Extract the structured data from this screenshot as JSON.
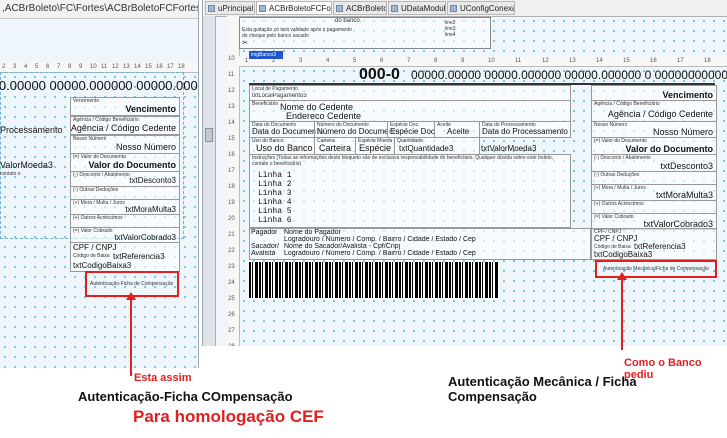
{
  "left": {
    "path": ",ACBrBoleto\\FC\\Fortes\\ACBrBoletoFCFortesFr.pas",
    "ruler_ticks": [
      "2",
      "3",
      "4",
      "5",
      "6",
      "7",
      "8",
      "9",
      "10",
      "11",
      "12",
      "13",
      "14",
      "15",
      "16",
      "17",
      "18"
    ],
    "row_numbers": [
      "12",
      "13",
      "14",
      "15",
      "16",
      "17",
      "18",
      "19",
      "20",
      "21"
    ],
    "linha_digitavel": "00000.00000 00000.000000 00000.000000 0 00000000000000",
    "labels": {
      "vencimento_small": "Vencimento",
      "agencia_small": "Agência / Código Beneficiário",
      "nosso_small": "Nosso Número",
      "valor_small": "(=) Valor do Documento",
      "desconto_small": "(-) Desconto / Abatimento",
      "outras_ded_small": "(-) Outras Deduções",
      "mora_small": "(+) Mora / Multa / Juros",
      "outros_acr_small": "(+) Outros Acréscimos",
      "cobrado_small": "(=) Valor Cobrado",
      "codigo_baixa_small": "Código de Baixa",
      "contato_small": "contato o"
    },
    "vencimento": "Vencimento",
    "agencia": "Agência / Código Cedente",
    "data_proc": "Processamento",
    "nosso_numero": "Nosso Número",
    "valor_moeda": "ValorMoeda3",
    "valor_documento": "Valor do Documento",
    "txt_desconto": "txtDesconto3",
    "txt_mora": "txtMoraMulta3",
    "txt_valor_cobrado": "txtValorCobrado3",
    "cpf": "CPF / CNPJ",
    "txt_referencia": "txtReferencia3",
    "txt_codigo_baixa": "txtCodigoBaixa3",
    "autenticacao_box": "Autenticação-Ficha de Compensação"
  },
  "right": {
    "tabs": [
      {
        "label": "uPrincipal",
        "active": false
      },
      {
        "label": "ACBrBoletoFCFortesFr",
        "active": true
      },
      {
        "label": "ACBrBoleto",
        "active": false
      },
      {
        "label": "UDataModule",
        "active": false
      },
      {
        "label": "UConfigConexao",
        "active": false
      }
    ],
    "top_lines": [
      "line2",
      "line3",
      "line4"
    ],
    "top_text": "Esta quitação só terá validade após o pagamento do cheque pelo banco sacado",
    "do_banco": "do banco.",
    "row_numbers": [
      "10",
      "11",
      "12",
      "13",
      "14",
      "15",
      "16",
      "17",
      "18",
      "19",
      "20",
      "21",
      "22",
      "23",
      "24",
      "25",
      "26",
      "27",
      "28"
    ],
    "ruler_ticks": [
      "1",
      "2",
      "3",
      "4",
      "5",
      "6",
      "7",
      "8",
      "9",
      "10",
      "11",
      "12",
      "13",
      "14",
      "15",
      "16",
      "17",
      "18"
    ],
    "logo_field": "imgBanco3",
    "banco_numero": "000-0",
    "linha_digitavel": "00000.00000 00000.000000 00000.000000 0 00000000000000",
    "local_pagamento_label": "Local de Pagamento",
    "local_pagamento": "txtLocalPagamento3",
    "vencimento_label": "Vencimento",
    "vencimento": "Vencimento",
    "beneficiario_label": "Beneficiário",
    "nome_cedente": "Nome do Cedente",
    "endereco_cedente": "Endereco Cedente",
    "agencia_label": "Agência / Código Beneficiário",
    "agencia": "Agência / Código Cedente",
    "data_doc_label": "Data do Documento",
    "data_doc": "Data do Documento",
    "num_doc_label": "Número do Documento",
    "num_doc": "Número do Documento",
    "especie_doc_label": "Espécie Doc.",
    "especie_doc": "Espécie Doc",
    "aceite_label": "Aceite",
    "aceite": "Aceite",
    "data_proc_label": "Data do Processamento",
    "data_proc": "Data do Processamento",
    "nosso_label": "Nosso Número",
    "nosso": "Nosso Número",
    "uso_banco_label": "Uso do Banco",
    "uso_banco": "Uso do Banco",
    "carteira_label": "Carteira",
    "carteira": "Carteira",
    "especie_label": "Espécie Moeda",
    "especie": "Espécie",
    "quantidade_label": "Quantidade",
    "quantidade": "txtQuantidade3",
    "valor_moeda": "txtValorMoeda3",
    "valor_doc_label": "(=) Valor do Documento",
    "valor_doc": "Valor do Documento",
    "instrucoes": "Instruções (Todas as informações deste bloqueto são de exclusiva responsabilidade do beneficiário. Qualquer dúvida sobre este boleto, contate o beneficiário)",
    "linhas": [
      "Linha 1",
      "Linha 2",
      "Linha 3",
      "Linha 4",
      "Linha 5",
      "Linha 6"
    ],
    "desconto_label": "(-) Desconto / Abatimento",
    "txt_desconto": "txtDesconto3",
    "outras_ded_label": "(-) Outras Deduções",
    "mora_label": "(+) Mora / Multa / Juros",
    "txt_mora": "txtMoraMulta3",
    "outros_acr_label": "(+) Outros Acréscimos",
    "cobrado_label": "(=) Valor Cobrado",
    "txt_cobrado": "txtValorCobrado3",
    "pagador_label": "Pagador",
    "nome_pagador": "Nome do Pagador",
    "logradouro1": "Logradouro / Número / Comp. / Bairro / Cidade / Estado / Cep",
    "sacador_label": "Sacador/",
    "avalista_label": "Avalista",
    "nome_sacador": "Nome do Sacador/Avalista - Cpf/Cnpj",
    "logradouro2": "Logradouro / Número / Comp. / Bairro / Cidade / Estado / Cep",
    "cpf_label": "CPF / CNPJ",
    "cpf": "CPF / CNPJ",
    "codigo_baixa_label": "Código de Baixa",
    "txt_referencia": "txtReferencia3",
    "txt_codigo_baixa": "txtCodigoBaixa3",
    "autenticacao_box": "Autenticação Mecânica/Ficha de Compensação"
  },
  "annotations": {
    "left_note": "Esta assim",
    "left_caption": "Autenticação-Ficha COmpensação",
    "left_subcaption": "Para homologação CEF",
    "right_note": "Como o Banco pediu",
    "right_caption": "Autenticação Mecânica / Ficha Compensação",
    "accent_color": "#e02020",
    "grid_color": "#55b7d6"
  }
}
